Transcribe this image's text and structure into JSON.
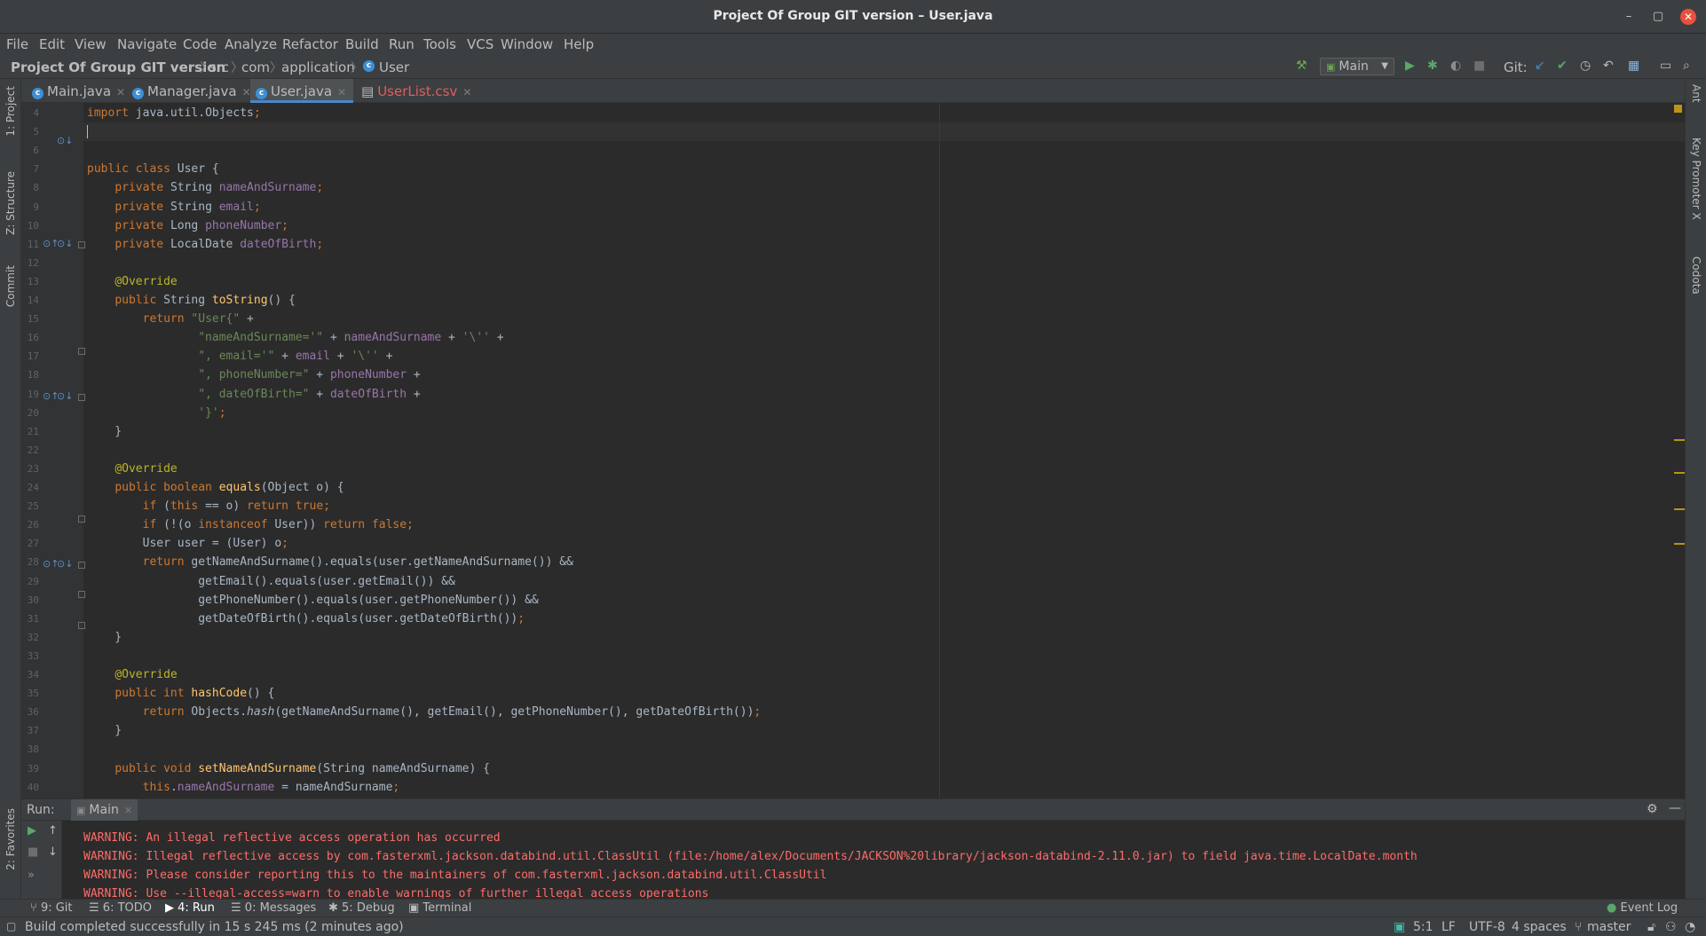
{
  "window": {
    "title": "Project Of Group GIT version – User.java"
  },
  "menu": [
    "File",
    "Edit",
    "View",
    "Navigate",
    "Code",
    "Analyze",
    "Refactor",
    "Build",
    "Run",
    "Tools",
    "VCS",
    "Window",
    "Help"
  ],
  "breadcrumb": {
    "project": "Project Of Group GIT version",
    "items": [
      "src",
      "com",
      "application",
      "User"
    ]
  },
  "toolbar": {
    "run_config": "Main",
    "git_label": "Git:"
  },
  "tabs": [
    {
      "label": "Main.java"
    },
    {
      "label": "Manager.java"
    },
    {
      "label": "User.java"
    },
    {
      "label": "UserList.csv"
    }
  ],
  "left_tools": [
    "1: Project",
    "Z: Structure",
    "Commit",
    "2: Favorites"
  ],
  "right_tools": [
    "Ant",
    "Key Promoter X",
    "Codota"
  ],
  "editor": {
    "line_numbers": [
      "4",
      "5",
      "6",
      "7",
      "8",
      "9",
      "10",
      "11",
      "12",
      "13",
      "14",
      "15",
      "16",
      "17",
      "18",
      "19",
      "20",
      "21",
      "22",
      "23",
      "24",
      "25",
      "26",
      "27",
      "28",
      "29",
      "30",
      "31",
      "32",
      "33",
      "34",
      "35",
      "36",
      "37",
      "38",
      "39",
      "40"
    ],
    "lines": [
      [
        [
          "kw",
          "import "
        ],
        [
          "",
          "java.util.Objects"
        ],
        [
          "kw",
          ";"
        ]
      ],
      [],
      [],
      [
        [
          "kw",
          "public class "
        ],
        [
          "",
          "User {"
        ]
      ],
      [
        [
          "",
          "    "
        ],
        [
          "kw",
          "private "
        ],
        [
          "",
          "String "
        ],
        [
          "fld",
          "nameAndSurname"
        ],
        [
          "kw",
          ";"
        ]
      ],
      [
        [
          "",
          "    "
        ],
        [
          "kw",
          "private "
        ],
        [
          "",
          "String "
        ],
        [
          "fld",
          "email"
        ],
        [
          "kw",
          ";"
        ]
      ],
      [
        [
          "",
          "    "
        ],
        [
          "kw",
          "private "
        ],
        [
          "",
          "Long "
        ],
        [
          "fld",
          "phoneNumber"
        ],
        [
          "kw",
          ";"
        ]
      ],
      [
        [
          "",
          "    "
        ],
        [
          "kw",
          "private "
        ],
        [
          "",
          "LocalDate "
        ],
        [
          "fld",
          "dateOfBirth"
        ],
        [
          "kw",
          ";"
        ]
      ],
      [],
      [
        [
          "",
          "    "
        ],
        [
          "ann",
          "@Override"
        ]
      ],
      [
        [
          "",
          "    "
        ],
        [
          "kw",
          "public "
        ],
        [
          "",
          "String "
        ],
        [
          "fn",
          "toString"
        ],
        [
          "",
          "() {"
        ]
      ],
      [
        [
          "",
          "        "
        ],
        [
          "kw",
          "return "
        ],
        [
          "str",
          "\"User{\""
        ],
        [
          "",
          " +"
        ]
      ],
      [
        [
          "",
          "                "
        ],
        [
          "str",
          "\"nameAndSurname='\""
        ],
        [
          "",
          " + "
        ],
        [
          "fld",
          "nameAndSurname"
        ],
        [
          "",
          " + "
        ],
        [
          "str",
          "'\\''"
        ],
        [
          "",
          " +"
        ]
      ],
      [
        [
          "",
          "                "
        ],
        [
          "str",
          "\", email='\""
        ],
        [
          "",
          " + "
        ],
        [
          "fld",
          "email"
        ],
        [
          "",
          " + "
        ],
        [
          "str",
          "'\\''"
        ],
        [
          "",
          " +"
        ]
      ],
      [
        [
          "",
          "                "
        ],
        [
          "str",
          "\", phoneNumber=\""
        ],
        [
          "",
          " + "
        ],
        [
          "fld",
          "phoneNumber"
        ],
        [
          "",
          " +"
        ]
      ],
      [
        [
          "",
          "                "
        ],
        [
          "str",
          "\", dateOfBirth=\""
        ],
        [
          "",
          " + "
        ],
        [
          "fld",
          "dateOfBirth"
        ],
        [
          "",
          " +"
        ]
      ],
      [
        [
          "",
          "                "
        ],
        [
          "str",
          "'}'"
        ],
        [
          "kw",
          ";"
        ]
      ],
      [
        [
          "",
          "    }"
        ]
      ],
      [],
      [
        [
          "",
          "    "
        ],
        [
          "ann",
          "@Override"
        ]
      ],
      [
        [
          "",
          "    "
        ],
        [
          "kw",
          "public boolean "
        ],
        [
          "fn",
          "equals"
        ],
        [
          "",
          "(Object o) {"
        ]
      ],
      [
        [
          "",
          "        "
        ],
        [
          "kw",
          "if "
        ],
        [
          "",
          "("
        ],
        [
          "kw",
          "this "
        ],
        [
          "",
          "== o) "
        ],
        [
          "kw",
          "return true;"
        ]
      ],
      [
        [
          "",
          "        "
        ],
        [
          "kw",
          "if "
        ],
        [
          "",
          "(!(o "
        ],
        [
          "kw",
          "instanceof "
        ],
        [
          "",
          "User)) "
        ],
        [
          "kw",
          "return false;"
        ]
      ],
      [
        [
          "",
          "        User user = (User) o"
        ],
        [
          "kw",
          ";"
        ]
      ],
      [
        [
          "",
          "        "
        ],
        [
          "kw",
          "return "
        ],
        [
          "",
          "getNameAndSurname().equals(user.getNameAndSurname()) &&"
        ]
      ],
      [
        [
          "",
          "                getEmail().equals(user.getEmail()) &&"
        ]
      ],
      [
        [
          "",
          "                getPhoneNumber().equals(user.getPhoneNumber()) &&"
        ]
      ],
      [
        [
          "",
          "                getDateOfBirth().equals(user.getDateOfBirth())"
        ],
        [
          "kw",
          ";"
        ]
      ],
      [
        [
          "",
          "    }"
        ]
      ],
      [],
      [
        [
          "",
          "    "
        ],
        [
          "ann",
          "@Override"
        ]
      ],
      [
        [
          "",
          "    "
        ],
        [
          "kw",
          "public int "
        ],
        [
          "fn",
          "hashCode"
        ],
        [
          "",
          "() {"
        ]
      ],
      [
        [
          "",
          "        "
        ],
        [
          "kw",
          "return "
        ],
        [
          "",
          "Objects."
        ],
        [
          "it",
          "hash"
        ],
        [
          "",
          "(getNameAndSurname(), getEmail(), getPhoneNumber(), getDateOfBirth())"
        ],
        [
          "kw",
          ";"
        ]
      ],
      [
        [
          "",
          "    }"
        ]
      ],
      [],
      [
        [
          "",
          "    "
        ],
        [
          "kw",
          "public void "
        ],
        [
          "fn",
          "setNameAndSurname"
        ],
        [
          "",
          "(String nameAndSurname) {"
        ]
      ],
      [
        [
          "",
          "        "
        ],
        [
          "kw",
          "this"
        ],
        [
          "",
          "."
        ],
        [
          "fld",
          "nameAndSurname"
        ],
        [
          "",
          " = nameAndSurname"
        ],
        [
          "kw",
          ";"
        ]
      ]
    ]
  },
  "run": {
    "label": "Run:",
    "tab": "Main",
    "output": [
      "WARNING: An illegal reflective access operation has occurred",
      "WARNING: Illegal reflective access by com.fasterxml.jackson.databind.util.ClassUtil (file:/home/alex/Documents/JACKSON%20library/jackson-databind-2.11.0.jar) to field java.time.LocalDate.month",
      "WARNING: Please consider reporting this to the maintainers of com.fasterxml.jackson.databind.util.ClassUtil",
      "WARNING: Use --illegal-access=warn to enable warnings of further illegal access operations"
    ]
  },
  "bottom_tabs": [
    "9: Git",
    "6: TODO",
    "4: Run",
    "0: Messages",
    "5: Debug",
    "Terminal"
  ],
  "event_log": "Event Log",
  "status": {
    "message": "Build completed successfully in 15 s 245 ms (2 minutes ago)",
    "position": "5:1",
    "line_sep": "LF",
    "encoding": "UTF-8",
    "indent": "4 spaces",
    "branch": "master"
  },
  "colors": {
    "keyword": "#cc7832",
    "field": "#9876aa",
    "string": "#6a8759",
    "annotation": "#bbb529",
    "method": "#ffc66d",
    "error": "#ff6b68"
  }
}
